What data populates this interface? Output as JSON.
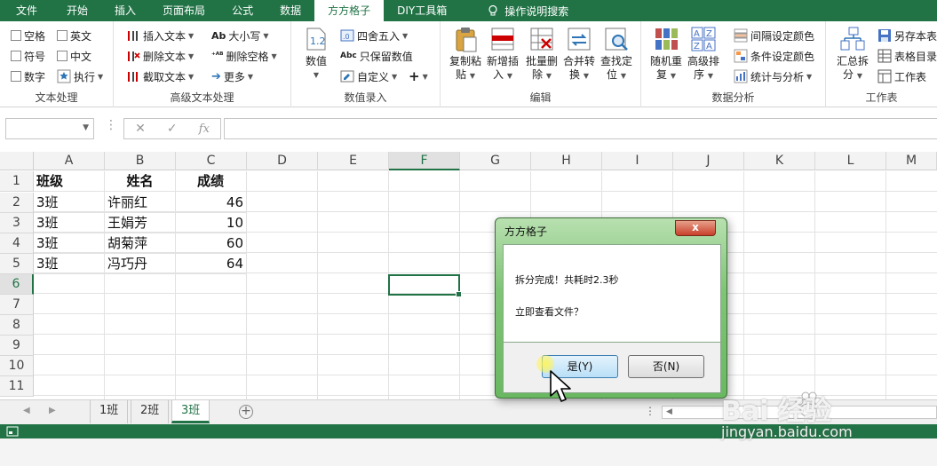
{
  "ribbon_tabs": [
    "文件",
    "开始",
    "插入",
    "页面布局",
    "公式",
    "数据",
    "方方格子",
    "DIY工具箱"
  ],
  "active_tab": "方方格子",
  "tell_me": "操作说明搜索",
  "groups": {
    "text": {
      "label": "文本处理",
      "items": [
        "空格",
        "英文",
        "符号",
        "中文",
        "数字",
        "执行"
      ]
    },
    "advtext": {
      "label": "高级文本处理",
      "items": [
        "插入文本",
        "删除文本",
        "截取文本",
        "大小写",
        "删除空格",
        "更多"
      ]
    },
    "numinput": {
      "label": "数值录入",
      "big": "数值",
      "items": [
        "四舍五入",
        "只保留数值",
        "自定义"
      ],
      "plus": "+"
    },
    "edit": {
      "label": "编辑",
      "buttons": [
        {
          "l1": "复制粘",
          "l2": "贴"
        },
        {
          "l1": "新增插",
          "l2": "入"
        },
        {
          "l1": "批量删",
          "l2": "除"
        },
        {
          "l1": "合并转",
          "l2": "换"
        },
        {
          "l1": "查找定",
          "l2": "位"
        }
      ]
    },
    "analysis": {
      "label": "数据分析",
      "buttons": [
        {
          "l1": "随机重",
          "l2": "复"
        },
        {
          "l1": "高级排",
          "l2": "序"
        }
      ],
      "items": [
        "间隔设定颜色",
        "条件设定颜色",
        "统计与分析"
      ]
    },
    "sheet": {
      "label": "工作表",
      "big": {
        "l1": "汇总拆",
        "l2": "分"
      },
      "items": [
        "另存本表",
        "表格目录",
        "工作表"
      ]
    }
  },
  "formula_bar": {
    "fx": "fx",
    "cancel": "✕",
    "enter": "✓",
    "value": ""
  },
  "columns": [
    "A",
    "B",
    "C",
    "D",
    "E",
    "F",
    "G",
    "H",
    "I",
    "J",
    "K",
    "L",
    "M"
  ],
  "selected_column": "F",
  "rows": [
    "1",
    "2",
    "3",
    "4",
    "5",
    "6",
    "7",
    "8",
    "9",
    "10",
    "11"
  ],
  "selected_row": "6",
  "table": {
    "headers": [
      "班级",
      "姓名",
      "成绩"
    ],
    "data": [
      [
        "3班",
        "许丽红",
        "46"
      ],
      [
        "3班",
        "王娟芳",
        "10"
      ],
      [
        "3班",
        "胡菊萍",
        "60"
      ],
      [
        "3班",
        "冯巧丹",
        "64"
      ]
    ]
  },
  "sheets": [
    "1班",
    "2班",
    "3班"
  ],
  "active_sheet": "3班",
  "dialog": {
    "title": "方方格子",
    "close": "x",
    "message1": "拆分完成！共耗时2.3秒",
    "message2": "立即查看文件？",
    "yes": "是(Y)",
    "no": "否(N)"
  },
  "watermark": {
    "brand": "Bai  经验",
    "url": "jingyan.baidu.com"
  },
  "colors": {
    "excel_green": "#217346",
    "dialog_green": "#7fc576"
  }
}
